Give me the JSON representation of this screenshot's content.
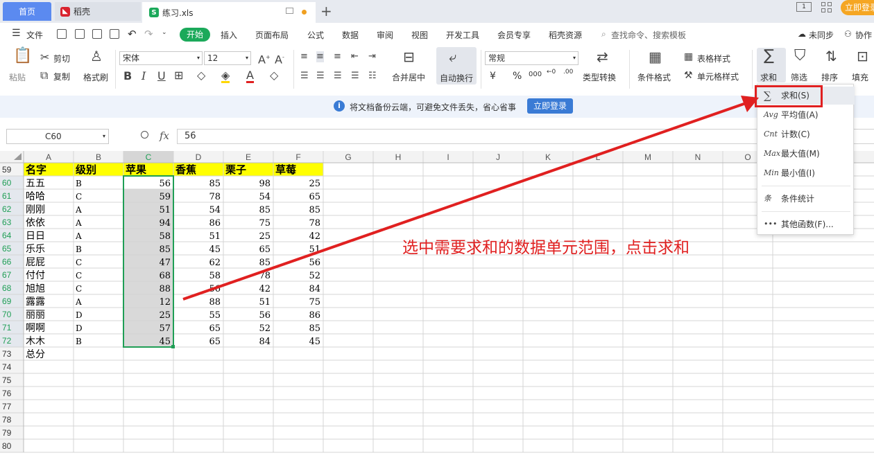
{
  "tabs": {
    "home": "首页",
    "daoke": "稻壳",
    "file": "练习.xls",
    "add": "+"
  },
  "topbar": {
    "login": "立即登录",
    "ico1": "1"
  },
  "menu": {
    "file": "文件",
    "start": "开始",
    "insert": "插入",
    "layout": "页面布局",
    "formula": "公式",
    "data": "数据",
    "review": "审阅",
    "view": "视图",
    "dev": "开发工具",
    "member": "会员专享",
    "daoke_res": "稻壳资源",
    "search": "查找命令、搜索模板",
    "unsync": "未同步",
    "collab": "协作"
  },
  "ribbon": {
    "paste": "粘贴",
    "cut": "剪切",
    "copy": "复制",
    "format_painter": "格式刷",
    "font": "宋体",
    "font_size": "12",
    "number_format": "常规",
    "merge": "合并居中",
    "autowrap": "自动换行",
    "type_convert": "类型转换",
    "cond_format": "条件格式",
    "table_style": "表格样式",
    "cell_style": "单元格样式",
    "sum": "求和",
    "filter": "筛选",
    "sort": "排序",
    "fill": "填充",
    "yuan": "¥",
    "percent": "%",
    "thousands": "000"
  },
  "notice": {
    "text": "将文档备份云端，可避免文件丢失，省心省事",
    "button": "立即登录"
  },
  "formula_bar": {
    "cell": "C60",
    "fx": "fx",
    "value": "56"
  },
  "sheet": {
    "columns": [
      "A",
      "B",
      "C",
      "D",
      "E",
      "F",
      "G",
      "H",
      "I",
      "J",
      "K",
      "L",
      "M",
      "N",
      "O"
    ],
    "selected_col": "C",
    "header_row": 59,
    "headers": [
      "名字",
      "级别",
      "苹果",
      "香蕉",
      "栗子",
      "草莓"
    ],
    "rows": [
      {
        "r": 60,
        "name": "五五",
        "lvl": "B",
        "v": [
          56,
          85,
          98,
          25
        ]
      },
      {
        "r": 61,
        "name": "哈哈",
        "lvl": "C",
        "v": [
          59,
          78,
          54,
          65
        ]
      },
      {
        "r": 62,
        "name": "刚刚",
        "lvl": "A",
        "v": [
          51,
          54,
          85,
          85
        ]
      },
      {
        "r": 63,
        "name": "依依",
        "lvl": "A",
        "v": [
          94,
          86,
          75,
          78
        ]
      },
      {
        "r": 64,
        "name": "日日",
        "lvl": "A",
        "v": [
          58,
          51,
          25,
          42
        ]
      },
      {
        "r": 65,
        "name": "乐乐",
        "lvl": "B",
        "v": [
          85,
          45,
          65,
          51
        ]
      },
      {
        "r": 66,
        "name": "屁屁",
        "lvl": "C",
        "v": [
          47,
          62,
          85,
          56
        ]
      },
      {
        "r": 67,
        "name": "付付",
        "lvl": "C",
        "v": [
          68,
          58,
          78,
          52
        ]
      },
      {
        "r": 68,
        "name": "旭旭",
        "lvl": "C",
        "v": [
          88,
          56,
          42,
          84
        ]
      },
      {
        "r": 69,
        "name": "露露",
        "lvl": "A",
        "v": [
          12,
          88,
          51,
          75
        ]
      },
      {
        "r": 70,
        "name": "丽丽",
        "lvl": "D",
        "v": [
          25,
          55,
          56,
          86
        ]
      },
      {
        "r": 71,
        "name": "啊啊",
        "lvl": "D",
        "v": [
          57,
          65,
          52,
          85
        ]
      },
      {
        "r": 72,
        "name": "木木",
        "lvl": "B",
        "v": [
          45,
          65,
          84,
          45
        ]
      }
    ],
    "total_row": 73,
    "total_label": "总分",
    "empty_rows": [
      74,
      75,
      76,
      77,
      78,
      79,
      80
    ]
  },
  "dropdown": [
    {
      "icon": "∑",
      "label": "求和(S)"
    },
    {
      "icon": "Avg",
      "label": "平均值(A)"
    },
    {
      "icon": "Cnt",
      "label": "计数(C)"
    },
    {
      "icon": "Max",
      "label": "最大值(M)"
    },
    {
      "icon": "Min",
      "label": "最小值(I)"
    },
    {
      "icon": "条",
      "label": "条件统计"
    },
    {
      "icon": "•••",
      "label": "其他函数(F)..."
    }
  ],
  "annotation": "选中需要求和的数据单元范围，点击求和",
  "colors": {
    "header_fill": "#ffff00",
    "selection": "#1f9e55",
    "annotation": "#e02020",
    "accent": "#1ba95a"
  }
}
